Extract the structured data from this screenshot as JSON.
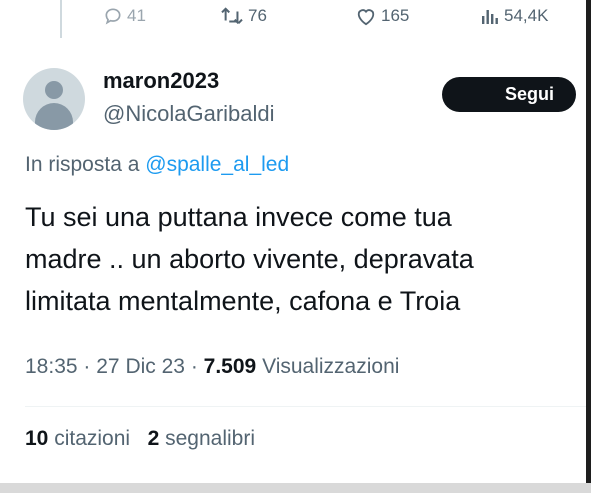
{
  "actions": {
    "replies": "41",
    "retweets": "76",
    "likes": "165",
    "views": "54,4K"
  },
  "author": {
    "display_name": "maron2023",
    "handle": "@NicolaGaribaldi"
  },
  "follow_button": {
    "label": "Segui"
  },
  "reply_context": {
    "prefix": "In risposta a",
    "mention": "@spalle_al_led"
  },
  "tweet": {
    "lines": [
      "Tu sei una puttana invece come tua",
      "madre .. un aborto vivente, depravata",
      "limitata mentalmente, cafona e Troia"
    ]
  },
  "meta": {
    "time": "18:35",
    "date": "27 Dic 23",
    "views_count": "7.509",
    "views_label": "Visualizzazioni",
    "separator": "·"
  },
  "engagement": {
    "quotes_count": "10",
    "quotes_label": "citazioni",
    "bookmarks_count": "2",
    "bookmarks_label": "segnalibri"
  },
  "colors": {
    "text": "#0f1419",
    "secondary": "#536471",
    "link": "#1d9bf0",
    "button_bg": "#0f1419"
  }
}
